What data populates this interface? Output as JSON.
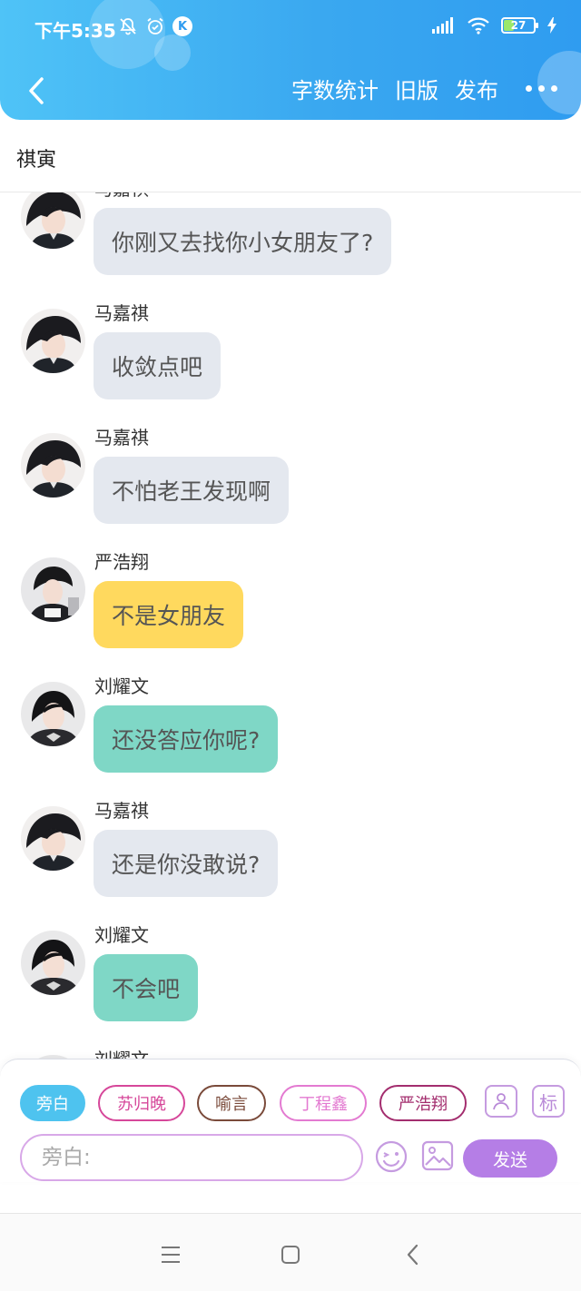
{
  "status_bar": {
    "time": "下午5:35",
    "battery": "27"
  },
  "toolbar": {
    "word_count_label": "字数统计",
    "old_version_label": "旧版",
    "publish_label": "发布"
  },
  "page": {
    "title": "祺寅"
  },
  "messages": [
    {
      "sender": "马嘉祺",
      "text": "你刚又去找你小女朋友了?",
      "color": "#e4e8ef"
    },
    {
      "sender": "马嘉祺",
      "text": "收敛点吧",
      "color": "#e4e8ef"
    },
    {
      "sender": "马嘉祺",
      "text": "不怕老王发现啊",
      "color": "#e4e8ef"
    },
    {
      "sender": "严浩翔",
      "text": "不是女朋友",
      "color": "#ffd95e"
    },
    {
      "sender": "刘耀文",
      "text": "还没答应你呢?",
      "color": "#7fd7c6"
    },
    {
      "sender": "马嘉祺",
      "text": "还是你没敢说?",
      "color": "#e4e8ef"
    },
    {
      "sender": "刘耀文",
      "text": "不会吧",
      "color": "#7fd7c6"
    },
    {
      "sender": "刘耀文",
      "text": "",
      "color": "#7fd7c6"
    }
  ],
  "roles": [
    {
      "label": "旁白",
      "color": "#4ec3ef",
      "selected": true
    },
    {
      "label": "苏归晚",
      "color": "#d6479a"
    },
    {
      "label": "喻言",
      "color": "#7a4a3a"
    },
    {
      "label": "丁程鑫",
      "color": "#e37ad1"
    },
    {
      "label": "严浩翔",
      "color": "#a32d6e"
    }
  ],
  "input": {
    "placeholder": "旁白:",
    "send_label": "发送",
    "mark_label": "标"
  }
}
